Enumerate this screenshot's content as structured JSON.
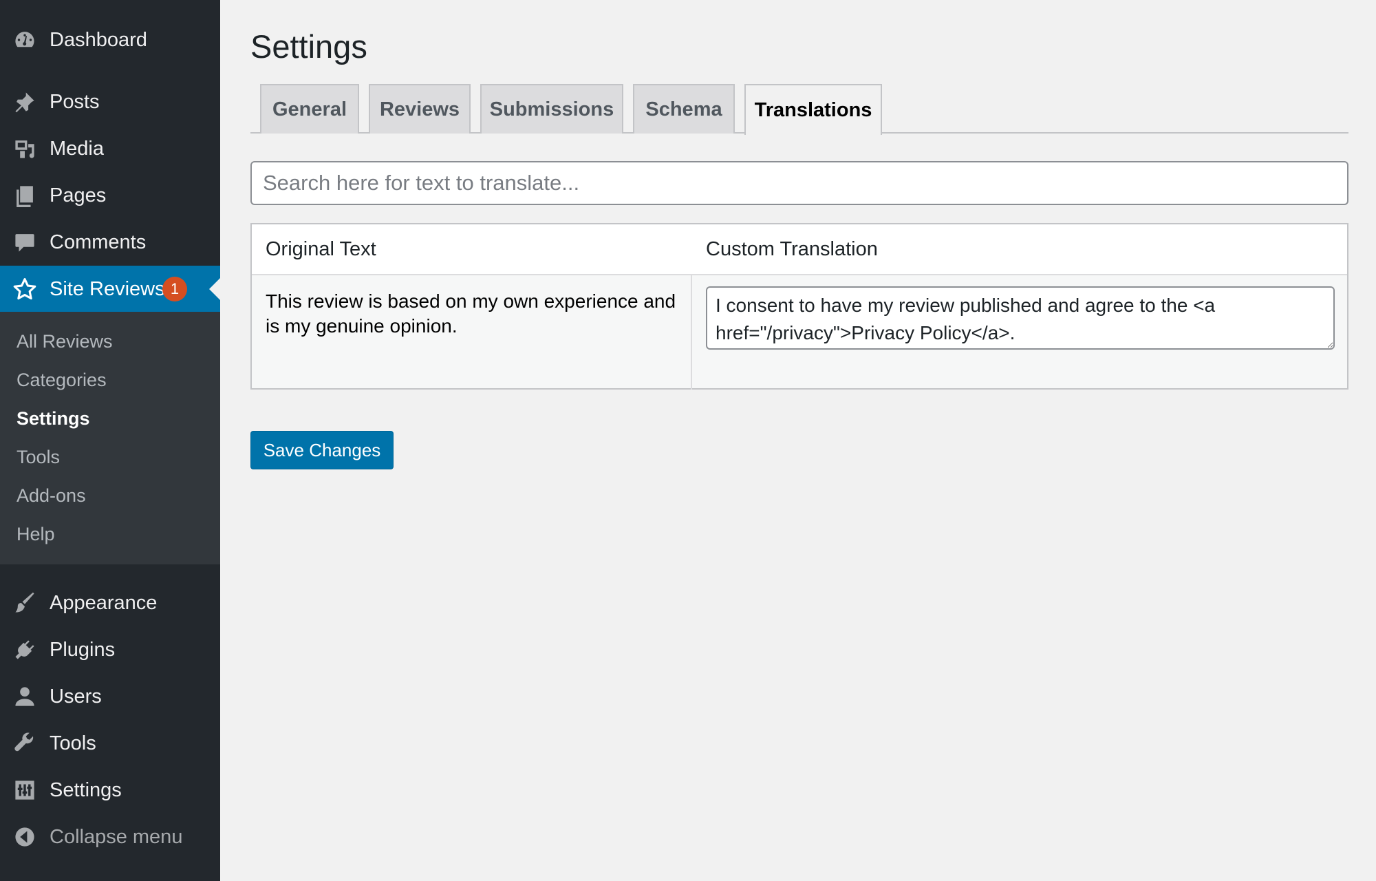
{
  "sidebar": {
    "items": [
      {
        "label": "Dashboard",
        "icon": "dashboard-icon"
      },
      {
        "label": "Posts",
        "icon": "pin-icon"
      },
      {
        "label": "Media",
        "icon": "media-icon"
      },
      {
        "label": "Pages",
        "icon": "pages-icon"
      },
      {
        "label": "Comments",
        "icon": "comment-icon"
      },
      {
        "label": "Site Reviews",
        "icon": "star-icon",
        "badge": "1",
        "active": true
      },
      {
        "label": "Appearance",
        "icon": "brush-icon"
      },
      {
        "label": "Plugins",
        "icon": "plug-icon"
      },
      {
        "label": "Users",
        "icon": "user-icon"
      },
      {
        "label": "Tools",
        "icon": "wrench-icon"
      },
      {
        "label": "Settings",
        "icon": "sliders-icon"
      },
      {
        "label": "Collapse menu",
        "icon": "collapse-icon"
      }
    ],
    "submenu": [
      "All Reviews",
      "Categories",
      "Settings",
      "Tools",
      "Add-ons",
      "Help"
    ],
    "submenu_current": "Settings"
  },
  "main": {
    "title": "Settings",
    "tabs": [
      {
        "label": "General"
      },
      {
        "label": "Reviews"
      },
      {
        "label": "Submissions"
      },
      {
        "label": "Schema"
      },
      {
        "label": "Translations",
        "active": true
      }
    ],
    "search": {
      "placeholder": "Search here for text to translate..."
    },
    "table": {
      "headers": [
        "Original Text",
        "Custom Translation"
      ],
      "rows": [
        {
          "original": "This review is based on my own experience and is my genuine opinion.",
          "translation": "I consent to have my review published and agree to the <a href=\"/privacy\">Privacy Policy</a>."
        }
      ]
    },
    "save_label": "Save Changes"
  },
  "colors": {
    "sidebar_bg": "#23282d",
    "submenu_bg": "#32373c",
    "accent": "#0073aa",
    "badge": "#d54e21",
    "page_bg": "#f1f1f1"
  }
}
